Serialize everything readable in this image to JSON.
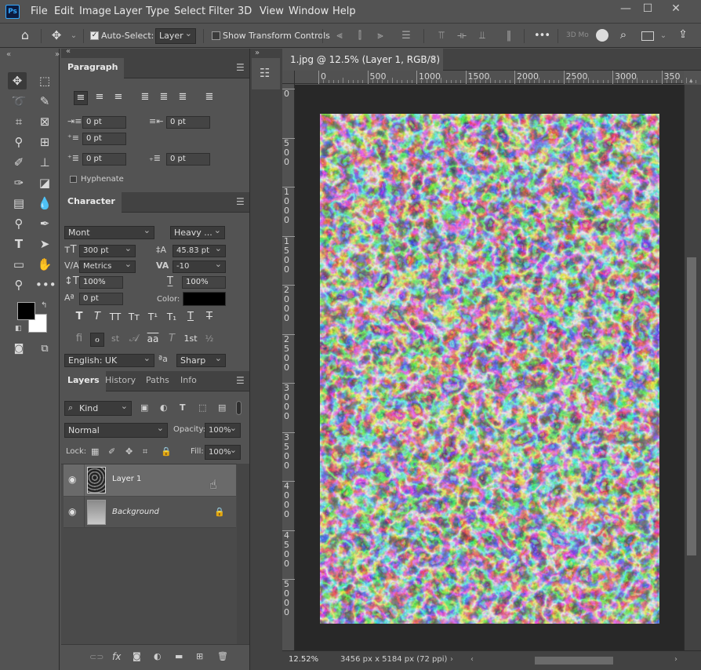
{
  "app": {
    "logo": "Ps"
  },
  "menu": [
    "File",
    "Edit",
    "Image",
    "Layer",
    "Type",
    "Select",
    "Filter",
    "3D",
    "View",
    "Window",
    "Help"
  ],
  "window_controls": {
    "minimize": "—",
    "maximize": "☐",
    "close": "✕"
  },
  "options": {
    "auto_select_label": "Auto-Select:",
    "auto_select_checked": true,
    "auto_select_target": "Layer",
    "show_transform_label": "Show Transform Controls",
    "show_transform_checked": false,
    "more": "•••",
    "mode_3d": "3D Mo"
  },
  "paragraph": {
    "tab": "Paragraph",
    "indent_left": "0 pt",
    "indent_right": "0 pt",
    "indent_first": "0 pt",
    "space_before": "0 pt",
    "space_after": "0 pt",
    "hyphenate_label": "Hyphenate",
    "hyphenate_checked": false
  },
  "character": {
    "tab": "Character",
    "font_family": "Mont",
    "font_style": "Heavy ...",
    "font_size": "300 pt",
    "leading": "45.83 pt",
    "kerning": "Metrics",
    "tracking": "-10",
    "vertical_scale": "100%",
    "horizontal_scale": "100%",
    "baseline_shift": "0 pt",
    "color_label": "Color:",
    "color": "#000000",
    "language": "English: UK",
    "antialias_icon": "ªa",
    "antialias": "Sharp",
    "style_buttons": [
      "T",
      "T",
      "TT",
      "Tт",
      "T¹",
      "T₁",
      "T",
      "T"
    ],
    "opentype_buttons": [
      "ﬁ",
      "ℴ",
      "st",
      "𝒜",
      "aa",
      "T",
      "1st",
      "½"
    ]
  },
  "layers_panel": {
    "tabs": [
      "Layers",
      "History",
      "Paths",
      "Info"
    ],
    "filter_kind": "Kind",
    "blend_mode": "Normal",
    "opacity_label": "Opacity:",
    "opacity": "100%",
    "lock_label": "Lock:",
    "fill_label": "Fill:",
    "fill": "100%",
    "layers": [
      {
        "name": "Layer 1",
        "visible": true,
        "selected": true,
        "locked": false
      },
      {
        "name": "Background",
        "visible": true,
        "selected": false,
        "locked": true
      }
    ]
  },
  "document": {
    "tab_title": "1.jpg @ 12.5% (Layer 1, RGB/8) *",
    "zoom": "12.52%",
    "info": "3456 px x 5184 px (72 ppi)",
    "ruler_h": [
      "0",
      "500",
      "1000",
      "1500",
      "2000",
      "2500",
      "3000",
      "350"
    ],
    "ruler_v": [
      "0",
      "5\n0\n0",
      "1\n0\n0\n0",
      "1\n5\n0\n0",
      "2\n0\n0\n0",
      "2\n5\n0\n0",
      "3\n0\n0\n0",
      "3\n5\n0\n0",
      "4\n0\n0\n0",
      "4\n5\n0\n0",
      "5\n0\n0\n0"
    ]
  },
  "colors": {
    "foreground": "#000000",
    "background": "#ffffff",
    "accent": "#31a8ff"
  }
}
